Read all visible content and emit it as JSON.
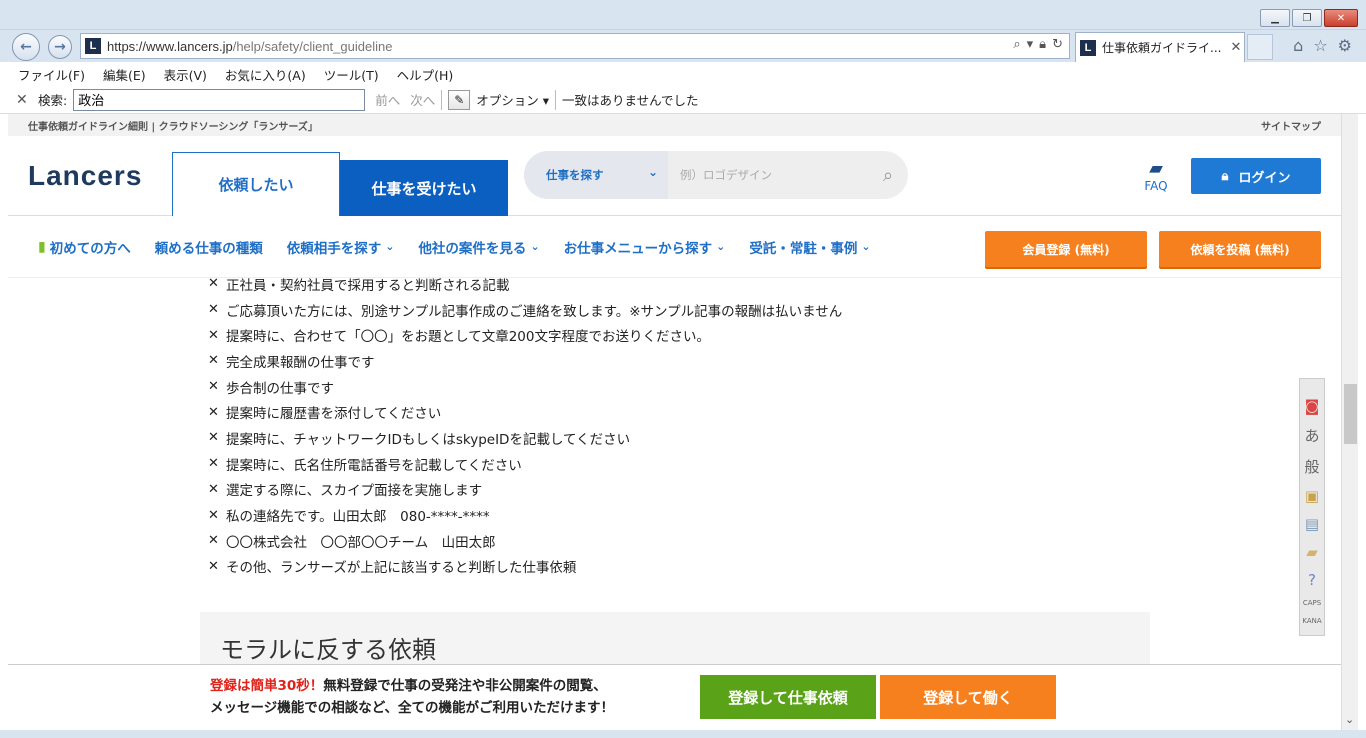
{
  "browser": {
    "url_host": "https://www.lancers.jp",
    "url_path": "/help/safety/client_guideline",
    "tab_title": "仕事依頼ガイドライ...",
    "favicon_letter": "L",
    "menu": [
      "ファイル(F)",
      "編集(E)",
      "表示(V)",
      "お気に入り(A)",
      "ツール(T)",
      "ヘルプ(H)"
    ],
    "find": {
      "label": "検索:",
      "value": "政治",
      "prev": "前へ",
      "next": "次へ",
      "options": "オプション",
      "status": "一致はありませんでした"
    }
  },
  "site": {
    "topstrip_left": "仕事依頼ガイドライン細則 | クラウドソーシング「ランサーズ」",
    "topstrip_right": "サイトマップ",
    "logo": "Lancers",
    "tab_client": "依頼したい",
    "tab_worker": "仕事を受けたい",
    "search_category": "仕事を探す",
    "search_placeholder": "例）ロゴデザイン",
    "faq": "FAQ",
    "login": "ログイン",
    "nav": [
      "初めての方へ",
      "頼める仕事の種類",
      "依頼相手を探す",
      "他社の案件を見る",
      "お仕事メニューから探す",
      "受託・常駐・事例"
    ],
    "btn_register": "会員登録 (無料)",
    "btn_post": "依頼を投稿 (無料)"
  },
  "content": {
    "items": [
      "正社員・契約社員で採用すると判断される記載",
      "ご応募頂いた方には、別途サンプル記事作成のご連絡を致します。※サンプル記事の報酬は払いません",
      "提案時に、合わせて「〇〇」をお題として文章200文字程度でお送りください。",
      "完全成果報酬の仕事です",
      "歩合制の仕事です",
      "提案時に履歴書を添付してください",
      "提案時に、チャットワークIDもしくはskypeIDを記載してください",
      "提案時に、氏名住所電話番号を記載してください",
      "選定する際に、スカイプ面接を実施します",
      "私の連絡先です。山田太郎　080-****-****",
      "〇〇株式会社　〇〇部〇〇チーム　山田太郎",
      "その他、ランサーズが上記に該当すると判断した仕事依頼"
    ],
    "section_title": "モラルに反する依頼"
  },
  "banner": {
    "red": "登録は簡単30秒！",
    "line1": "無料登録で仕事の受発注や非公開案件の閲覧、",
    "line2": "メッセージ機能での相談など、全ての機能がご利用いただけます！",
    "btn_client": "登録して仕事依頼",
    "btn_work": "登録して働く"
  },
  "ime": {
    "kana": "あ",
    "mode": "般",
    "caps": "CAPS",
    "kana_label": "KANA"
  }
}
